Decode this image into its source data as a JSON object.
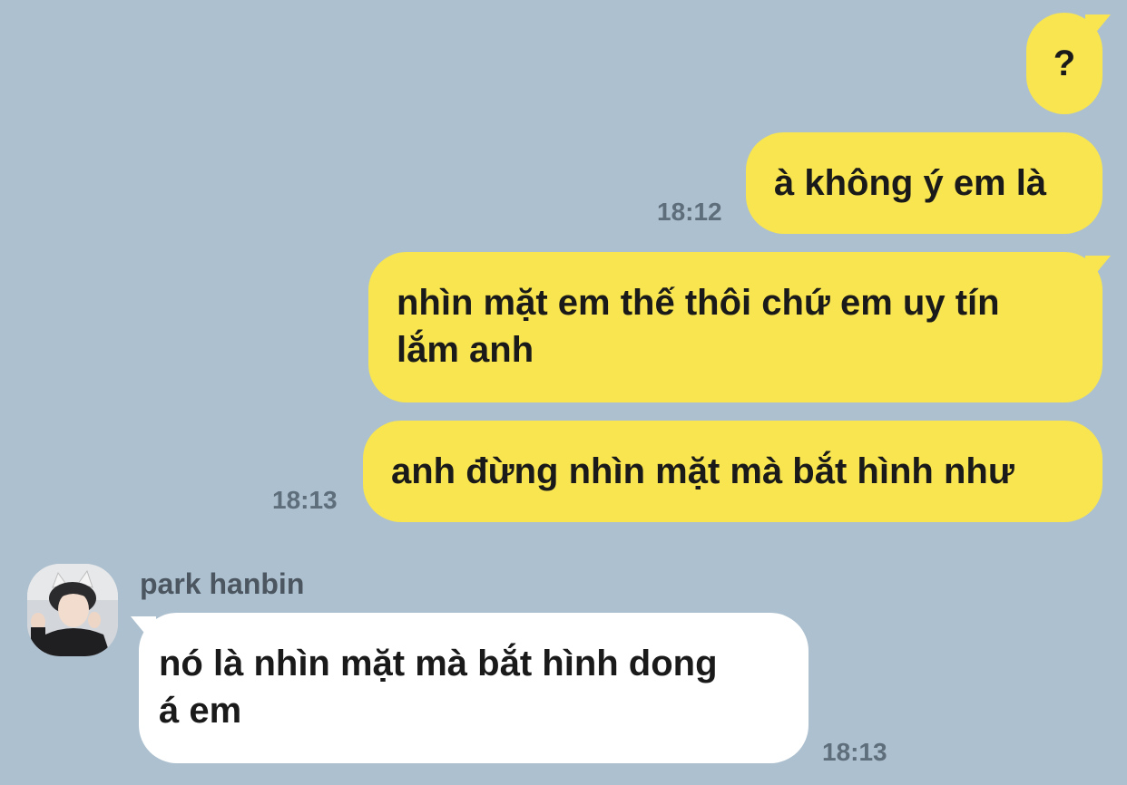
{
  "chat": {
    "messages": [
      {
        "id": "m1",
        "direction": "outgoing",
        "text": "?",
        "time": ""
      },
      {
        "id": "m2",
        "direction": "outgoing",
        "text": "à không ý em là",
        "time": "18:12"
      },
      {
        "id": "m3",
        "direction": "outgoing",
        "lines": [
          "nhìn mặt em thế thôi chứ em uy tín",
          "lắm anh"
        ],
        "time": ""
      },
      {
        "id": "m4",
        "direction": "outgoing",
        "text": "anh đừng nhìn mặt mà bắt hình như",
        "time": "18:13"
      },
      {
        "id": "m5",
        "direction": "incoming",
        "sender": "park hanbin",
        "lines": [
          "nó là nhìn mặt mà bắt hình dong",
          "á em"
        ],
        "time": "18:13"
      }
    ]
  },
  "colors": {
    "background": "#adc0cf",
    "outgoing_bubble": "#f8e54f",
    "incoming_bubble": "#ffffff",
    "timestamp": "#5f6e7b"
  },
  "icons": {
    "avatar": "profile-photo-avatar"
  }
}
